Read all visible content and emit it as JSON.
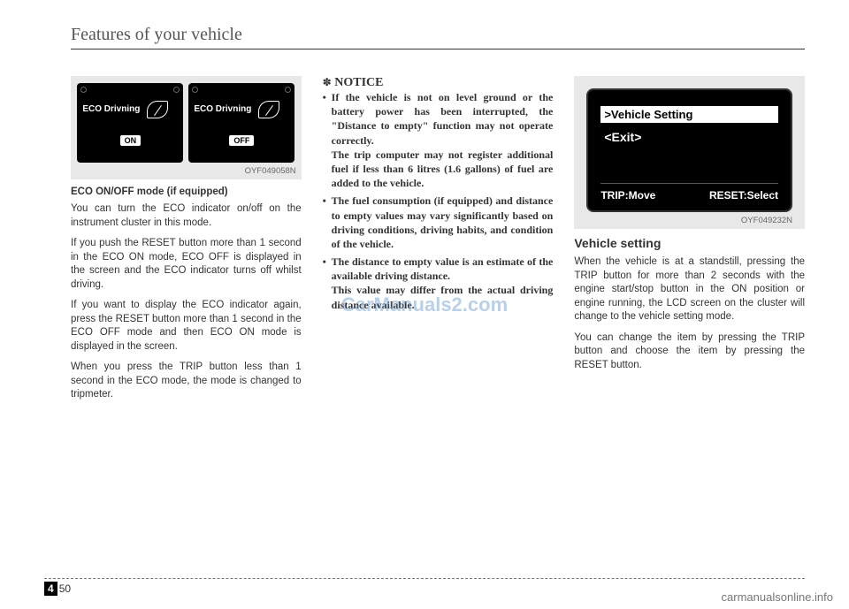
{
  "header": "Features of your vehicle",
  "watermark": "CarManuals2.com",
  "footer_site": "carmanualsonline.info",
  "page": {
    "section": "4",
    "number": "50"
  },
  "col1": {
    "fig": {
      "eco_label": "ECO Drivning",
      "on": "ON",
      "off": "OFF",
      "code": "OYF049058N"
    },
    "heading": "ECO ON/OFF mode (if equipped)",
    "p1": "You can turn the ECO indicator on/off on the instrument cluster in this mode.",
    "p2": "If you push the RESET button more than 1 second in the ECO ON mode, ECO OFF is displayed in the screen and the ECO indicator turns off whilst driving.",
    "p3": "If you want to display the ECO indicator again, press the RESET button more than 1 second in the ECO OFF mode and then ECO ON mode is displayed in the screen.",
    "p4": "When you press the TRIP button less than 1 second in the ECO mode, the mode is changed to tripmeter."
  },
  "col2": {
    "notice_symbol": "✽",
    "notice_label": "NOTICE",
    "b1": "If the vehicle is not on level ground or the battery power has been interrupted, the \"Distance to empty\" function may not operate correctly.",
    "b1b": "The trip computer may not register additional fuel if less than 6 litres (1.6 gallons) of fuel are added to the vehicle.",
    "b2": "The fuel consumption (if equipped) and distance to empty values may vary significantly based on driving conditions, driving habits, and condition of the vehicle.",
    "b3": "The distance to empty value is an estimate of the available driving distance.",
    "b3b": "This value may differ from the actual driving distance available."
  },
  "col3": {
    "fig": {
      "row1": ">Vehicle Setting",
      "row2": "<Exit>",
      "bottom_left": "TRIP:Move",
      "bottom_right": "RESET:Select",
      "code": "OYF049232N"
    },
    "heading": "Vehicle setting",
    "p1": "When the vehicle is at a standstill, pressing the TRIP button for more than 2 seconds with the engine start/stop button in the ON position or engine running, the LCD screen on the cluster will change to the vehicle setting mode.",
    "p2": "You can change the item by pressing the TRIP button and choose the item by pressing the RESET button."
  }
}
